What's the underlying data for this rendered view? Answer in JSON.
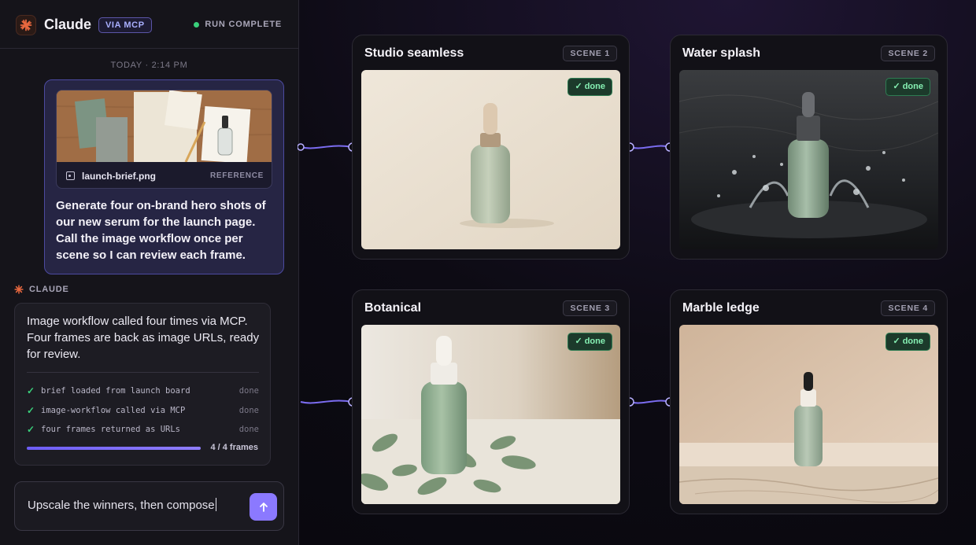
{
  "header": {
    "app_title": "Claude",
    "mcp_badge": "VIA MCP",
    "run_status": "RUN COMPLETE",
    "status_color": "#3ad07b"
  },
  "conversation": {
    "timestamp": "TODAY · 2:14 PM",
    "user_message": {
      "attachment": {
        "filename": "launch-brief.png",
        "tag": "REFERENCE"
      },
      "text": "Generate four on-brand hero shots of our new serum for the launch page. Call the image workflow once per scene so I can review each frame."
    },
    "assistant": {
      "label": "CLAUDE",
      "text": "Image workflow called four times via MCP. Four frames are back as image URLs, ready for review.",
      "steps": [
        {
          "label": "brief loaded from launch board",
          "status": "done"
        },
        {
          "label": "image-workflow called via MCP",
          "status": "done"
        },
        {
          "label": "four frames returned as URLs",
          "status": "done"
        }
      ],
      "progress": {
        "completed": 4,
        "total": 4,
        "label": "4 / 4 frames"
      }
    }
  },
  "composer": {
    "value": "Upscale the winners, then compose",
    "send_icon": "arrow-up-icon"
  },
  "scenes": [
    {
      "title": "Studio seamless",
      "tag": "SCENE 1",
      "badge": "✓ done"
    },
    {
      "title": "Water splash",
      "tag": "SCENE 2",
      "badge": "✓ done"
    },
    {
      "title": "Botanical",
      "tag": "SCENE 3",
      "badge": "✓ done"
    },
    {
      "title": "Marble ledge",
      "tag": "SCENE 4",
      "badge": "✓ done"
    }
  ],
  "colors": {
    "accent": "#8b79ff",
    "success": "#3ad07b",
    "connector": "#7b6cf0"
  }
}
